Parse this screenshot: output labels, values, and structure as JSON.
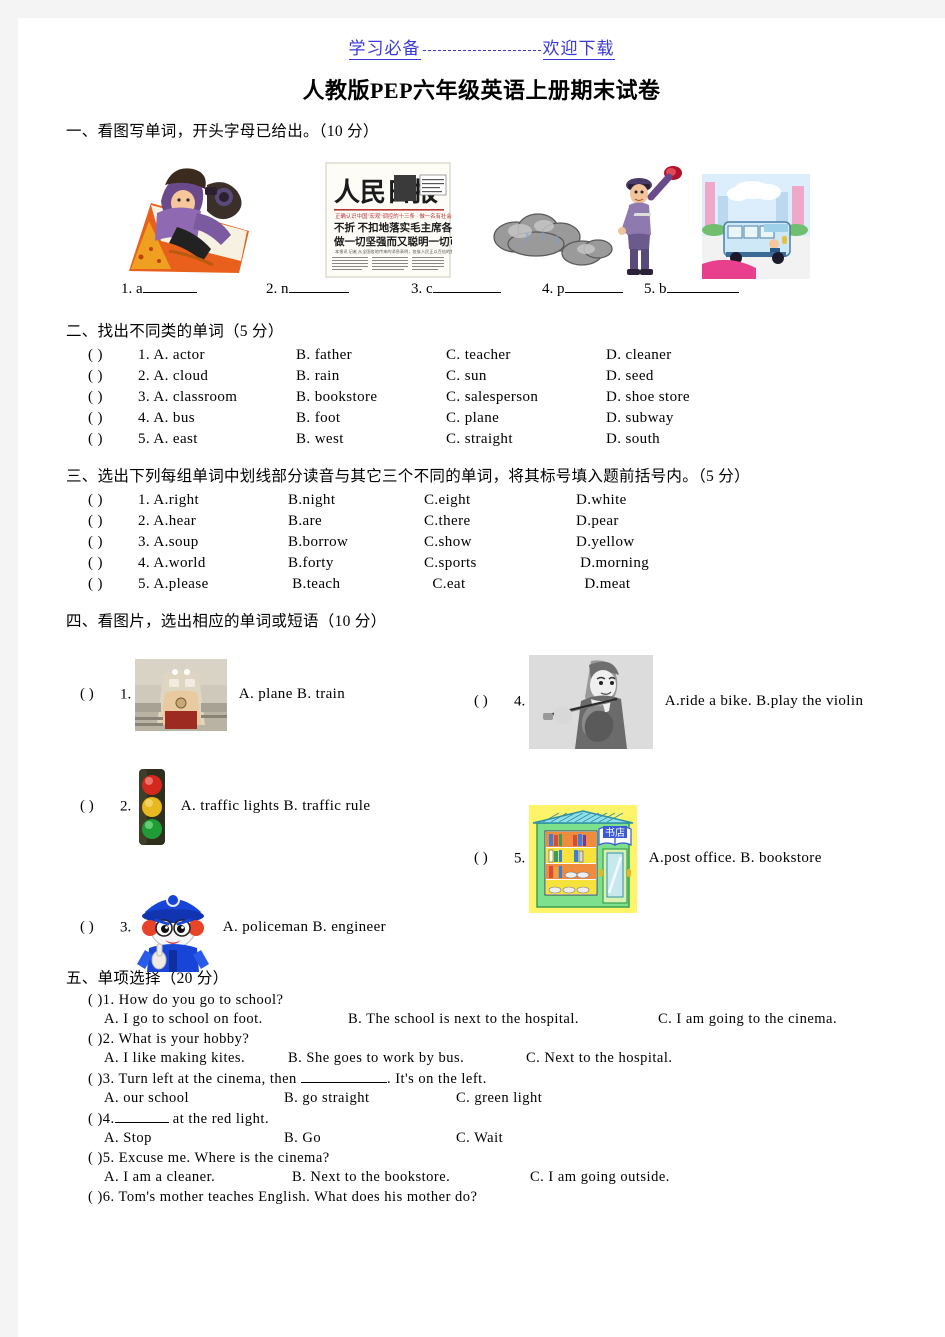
{
  "watermark": {
    "left": "学习必备",
    "right": "欢迎下载"
  },
  "title": "人教版PEP六年级英语上册期末试卷",
  "section1": {
    "heading": "一、看图写单词，开头字母已给出。（10 分）",
    "images": [
      {
        "name": "artist-drawing-picture",
        "alt": "artist drawing"
      },
      {
        "name": "newspaper-renmin-ribao",
        "alt": "newspaper"
      },
      {
        "name": "clouds",
        "alt": "clouds"
      },
      {
        "name": "policeman-with-flag",
        "alt": "policeman"
      },
      {
        "name": "bus-on-street",
        "alt": "bus"
      }
    ],
    "blanks": [
      {
        "num": "1.",
        "letter": "a"
      },
      {
        "num": "2.",
        "letter": "n"
      },
      {
        "num": "3.",
        "letter": "c"
      },
      {
        "num": "4.",
        "letter": "p"
      },
      {
        "num": "5.",
        "letter": "b"
      }
    ]
  },
  "section2": {
    "heading": "二、找出不同类的单词（5 分）",
    "rows": [
      {
        "paren": "(        )",
        "num": "1.",
        "a": "A.  actor",
        "b": "B.  father",
        "c": "C.  teacher",
        "d": "D.  cleaner"
      },
      {
        "paren": "(        )",
        "num": "2.",
        "a": "A.  cloud",
        "b": "B.  rain",
        "c": "C.  sun",
        "d": "D.  seed"
      },
      {
        "paren": "(        )",
        "num": "3.",
        "a": "A.  classroom",
        "b": "B.  bookstore",
        "c": "C.  salesperson",
        "d": "D.  shoe store"
      },
      {
        "paren": "(        )",
        "num": "4.",
        "a": "A.  bus",
        "b": "B.  foot",
        "c": "C.  plane",
        "d": "D.  subway"
      },
      {
        "paren": "(        )",
        "num": "5.",
        "a": "A.  east",
        "b": "B.  west",
        "c": "C.  straight",
        "d": "D.  south"
      }
    ]
  },
  "section3": {
    "heading": "三、选出下列每组单词中划线部分读音与其它三个不同的单词，将其标号填入题前括号内。（5 分）",
    "rows": [
      {
        "paren": "(        )",
        "num": "1.",
        "a": "A.right",
        "b": "B.night",
        "c": "C.eight",
        "d": "D.white"
      },
      {
        "paren": "(        )",
        "num": "2.",
        "a": "A.hear",
        "b": "B.are",
        "c": "C.there",
        "d": "D.pear"
      },
      {
        "paren": "(        )",
        "num": "3.",
        "a": "A.soup",
        "b": "B.borrow",
        "c": "C.show",
        "d": "D.yellow"
      },
      {
        "paren": "(        )",
        "num": "4.",
        "a": "A.world",
        "b": "B.forty",
        "c": "C.sports",
        "d": "D.morning"
      },
      {
        "paren": "(        )",
        "num": "5.",
        "a": "A.please",
        "b": "B.teach",
        "c": "C.eat",
        "d": "D.meat"
      }
    ]
  },
  "section4": {
    "heading": "四、看图片，选出相应的单词或短语（10 分）",
    "items": [
      {
        "paren": "(       )",
        "num": "1.",
        "image": "train-photo",
        "options": "A.  plane    B.  train"
      },
      {
        "paren": "(       )",
        "num": "2.",
        "image": "traffic-light",
        "options": "A.  traffic  lights    B.  traffic  rule"
      },
      {
        "paren": "(       )",
        "num": "3.",
        "image": "policeman-mascot",
        "options": "A.  policeman B.  engineer"
      },
      {
        "paren": "(       )",
        "num": "4.",
        "image": "violin-player",
        "options": "A.ride  a  bike. B.play  the  violin"
      },
      {
        "paren": "(       )",
        "num": "5.",
        "image": "bookstore-shop",
        "options": "A.post  office.    B.  bookstore"
      }
    ]
  },
  "section5": {
    "heading": "五、单项选择（20 分）",
    "questions": [
      {
        "paren": "(      )",
        "num": "1.",
        "stem": "How do you go to school?",
        "a": "A. I go to school on foot.",
        "b": "B. The school is next to the hospital.",
        "c": "C. I am going to the cinema."
      },
      {
        "paren": "(      )",
        "num": "2.",
        "stem": "What is your hobby?",
        "a": "A. I like making kites.",
        "b": "B. She goes to work by bus.",
        "c": "C. Next to the hospital."
      },
      {
        "paren": "(      )",
        "num": "3.",
        "stem_pre": "Turn left at the cinema, then",
        "stem_post": ". It's on the left.",
        "a": "A. our school",
        "b": "B. go straight",
        "c": "C. green light"
      },
      {
        "paren": "(      )",
        "num": "4.",
        "stem_pre": "",
        "stem_post": "at the red light.",
        "a": "A. Stop",
        "b": "B. Go",
        "c": "C. Wait"
      },
      {
        "paren": "(      )",
        "num": "5.",
        "stem": "Excuse me. Where is the cinema?",
        "a": "A. I am a cleaner.",
        "b": "B. Next to the bookstore.",
        "c": "C. I am going outside."
      },
      {
        "paren": "(      )",
        "num": "6.",
        "stem": "Tom's mother teaches English. What does his mother do?"
      }
    ]
  },
  "colors": {
    "watermark": "#3b38d8",
    "text": "#000000",
    "page_bg": "#ffffff",
    "margin_bg": "#f4f4f4"
  }
}
